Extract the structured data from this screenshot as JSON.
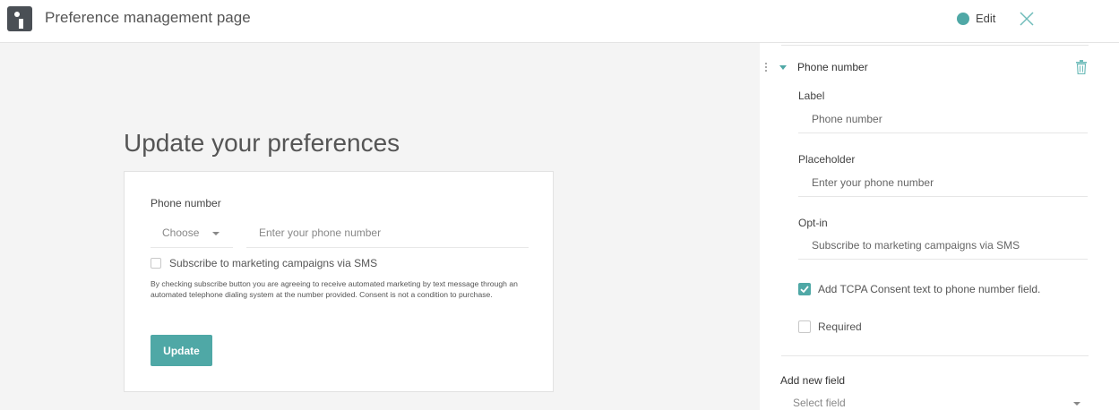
{
  "header": {
    "title": "Preference management page",
    "edit_label": "Edit",
    "accent": "#4fa8a6"
  },
  "preview": {
    "heading": "Update your preferences",
    "phone_label": "Phone number",
    "choose_label": "Choose",
    "phone_placeholder": "Enter your phone number",
    "sms_label": "Subscribe to marketing campaigns via SMS",
    "disclaimer": "By checking subscribe button you are agreeing to receive automated marketing by text message through an automated telephone dialing system at the number provided. Consent is not a condition to purchase.",
    "update_button": "Update"
  },
  "panel": {
    "field_title": "Phone number",
    "label_heading": "Label",
    "label_value": "Phone number",
    "placeholder_heading": "Placeholder",
    "placeholder_value": "Enter your phone number",
    "optin_heading": "Opt-in",
    "optin_value": "Subscribe to marketing campaigns via SMS",
    "tcpa_label": "Add TCPA Consent text to phone number field.",
    "tcpa_checked": true,
    "required_label": "Required",
    "required_checked": false,
    "add_field_heading": "Add new field",
    "select_field_placeholder": "Select field"
  },
  "icons": {
    "logo": "logo-icon",
    "close": "close-icon",
    "trash": "trash-icon",
    "drag": "drag-handle-icon",
    "caret": "chevron-down-icon",
    "check": "check-icon"
  }
}
